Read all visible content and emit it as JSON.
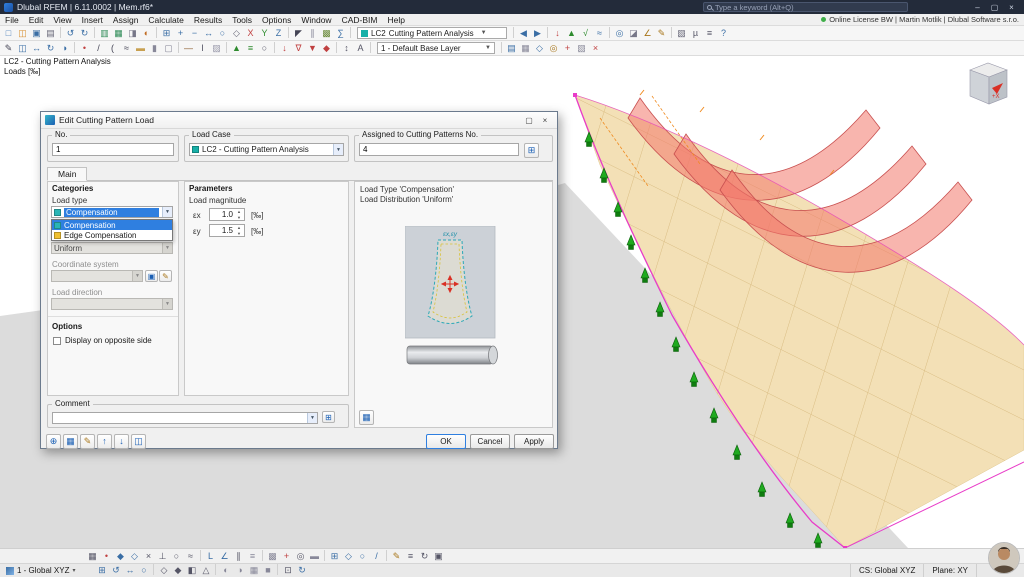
{
  "window": {
    "title": "Dlubal RFEM | 6.11.0002 | Mem.rf6*",
    "search_placeholder": "Type a keyword (Alt+Q)",
    "license": "Online License BW | Martin Motlik | Dlubal Software s.r.o.",
    "controls": [
      {
        "n": "window-minimize",
        "g": "–"
      },
      {
        "n": "window-maximize",
        "g": "▢"
      },
      {
        "n": "window-close",
        "g": "×"
      }
    ]
  },
  "menu": {
    "items": [
      "File",
      "Edit",
      "View",
      "Insert",
      "Assign",
      "Calculate",
      "Results",
      "Tools",
      "Options",
      "Window",
      "CAD-BIM",
      "Help"
    ]
  },
  "toolbar1": {
    "load_case": {
      "code": "LC2",
      "name": "Cutting Pattern Analysis"
    },
    "icons_pre": [
      {
        "n": "new-model",
        "g": "□",
        "c": "#4a7ebb"
      },
      {
        "n": "open-model",
        "g": "◫",
        "c": "#d89030"
      },
      {
        "n": "save-model",
        "g": "▣",
        "c": "#3a6ea5"
      },
      {
        "n": "print-graphic",
        "g": "▤",
        "c": "#667"
      },
      {
        "g": "|"
      },
      {
        "n": "undo",
        "g": "↺",
        "c": "#3a6ea5"
      },
      {
        "n": "redo",
        "g": "↻",
        "c": "#3a6ea5"
      },
      {
        "g": "|"
      },
      {
        "n": "data-navigator",
        "g": "▥",
        "c": "#2e8b57"
      },
      {
        "n": "tables",
        "g": "▦",
        "c": "#2e8b57"
      },
      {
        "n": "display-panel",
        "g": "◨",
        "c": "#778"
      },
      {
        "n": "rendering",
        "g": "◐",
        "c": "#c06a20"
      },
      {
        "g": "|"
      },
      {
        "n": "zoom-window",
        "g": "⊞",
        "c": "#3a6ea5"
      },
      {
        "n": "zoom-in",
        "g": "+",
        "c": "#3a6ea5"
      },
      {
        "n": "zoom-out",
        "g": "−",
        "c": "#3a6ea5"
      },
      {
        "n": "pan-view",
        "g": "↔",
        "c": "#3a6ea5"
      },
      {
        "n": "orbit-view",
        "g": "○",
        "c": "#3a6ea5"
      },
      {
        "n": "view-isometric",
        "g": "◇",
        "c": "#667"
      },
      {
        "n": "view-in-x",
        "g": "X",
        "c": "#c04040"
      },
      {
        "n": "view-in-y",
        "g": "Y",
        "c": "#2e8b2e"
      },
      {
        "n": "view-in-z",
        "g": "Z",
        "c": "#3a6ea5"
      },
      {
        "g": "|"
      },
      {
        "n": "selection-arrow",
        "g": "◤",
        "c": "#445"
      },
      {
        "n": "guidelines",
        "g": "∥",
        "c": "#889"
      },
      {
        "n": "generate-mesh",
        "g": "▩",
        "c": "#6a8a3a"
      },
      {
        "n": "calculate-all",
        "g": "∑",
        "c": "#3a6ea5"
      },
      {
        "g": "|"
      }
    ],
    "icons_post": [
      {
        "g": "|"
      },
      {
        "n": "previous-load-case",
        "g": "◀",
        "c": "#3a6ea5"
      },
      {
        "n": "next-load-case",
        "g": "▶",
        "c": "#3a6ea5"
      },
      {
        "g": "|"
      },
      {
        "n": "show-loads",
        "g": "↓",
        "c": "#c04040"
      },
      {
        "n": "show-supports",
        "g": "▲",
        "c": "#2e8b2e"
      },
      {
        "n": "show-results",
        "g": "√",
        "c": "#2e8b2e"
      },
      {
        "n": "result-diagrams",
        "g": "≈",
        "c": "#3a6ea5"
      },
      {
        "g": "|"
      },
      {
        "n": "visibility-modes",
        "g": "◎",
        "c": "#3a6ea5"
      },
      {
        "n": "clipping-planes",
        "g": "◪",
        "c": "#778"
      },
      {
        "n": "measure",
        "g": "∠",
        "c": "#a8761a"
      },
      {
        "n": "annotations",
        "g": "✎",
        "c": "#a8761a"
      },
      {
        "g": "|"
      },
      {
        "n": "printout-report",
        "g": "▧",
        "c": "#667"
      },
      {
        "n": "units-settings",
        "g": "µ",
        "c": "#556"
      },
      {
        "n": "configuration",
        "g": "≡",
        "c": "#556"
      },
      {
        "n": "help",
        "g": "?",
        "c": "#3a6ea5"
      }
    ]
  },
  "toolbar2": {
    "layer": "1 - Default Base Layer",
    "icons_pre": [
      {
        "n": "edit-mode",
        "g": "✎",
        "c": "#445"
      },
      {
        "n": "copy-object",
        "g": "◫",
        "c": "#3a6ea5"
      },
      {
        "n": "move-object",
        "g": "↔",
        "c": "#3a6ea5"
      },
      {
        "n": "rotate-object",
        "g": "↻",
        "c": "#3a6ea5"
      },
      {
        "n": "mirror-object",
        "g": "◑",
        "c": "#3a6ea5"
      },
      {
        "g": "|"
      },
      {
        "n": "new-node",
        "g": "•",
        "c": "#c04040"
      },
      {
        "n": "new-line",
        "g": "/",
        "c": "#445"
      },
      {
        "n": "new-arc",
        "g": "(",
        "c": "#445"
      },
      {
        "n": "new-spline",
        "g": "≈",
        "c": "#445"
      },
      {
        "n": "new-surface",
        "g": "▬",
        "c": "#c8a050"
      },
      {
        "n": "new-solid",
        "g": "▮",
        "c": "#889"
      },
      {
        "n": "new-opening",
        "g": "▢",
        "c": "#889"
      },
      {
        "g": "|"
      },
      {
        "n": "new-member",
        "g": "—",
        "c": "#8b5a2b"
      },
      {
        "n": "cross-section",
        "g": "I",
        "c": "#556"
      },
      {
        "n": "material",
        "g": "▨",
        "c": "#99a"
      },
      {
        "g": "|"
      },
      {
        "n": "nodal-support",
        "g": "▲",
        "c": "#2e8b2e"
      },
      {
        "n": "line-support",
        "g": "≡",
        "c": "#2e8b2e"
      },
      {
        "n": "member-hinge",
        "g": "○",
        "c": "#556"
      },
      {
        "g": "|"
      },
      {
        "n": "nodal-load",
        "g": "↓",
        "c": "#c04040"
      },
      {
        "n": "line-load",
        "g": "∇",
        "c": "#c04040"
      },
      {
        "n": "surface-load",
        "g": "▼",
        "c": "#c04040"
      },
      {
        "n": "free-load",
        "g": "◆",
        "c": "#c04040"
      },
      {
        "g": "|"
      },
      {
        "n": "dimensions",
        "g": "↕",
        "c": "#556"
      },
      {
        "n": "text-annotation",
        "g": "A",
        "c": "#556"
      },
      {
        "g": "|"
      }
    ],
    "icons_post": [
      {
        "g": "|"
      },
      {
        "n": "layer-manager",
        "g": "▤",
        "c": "#3a6ea5"
      },
      {
        "n": "grid-settings",
        "g": "▦",
        "c": "#889"
      },
      {
        "n": "work-plane",
        "g": "◇",
        "c": "#3a6ea5"
      },
      {
        "n": "snap-settings",
        "g": "◎",
        "c": "#a8761a"
      },
      {
        "n": "user-coordinate-system",
        "g": "+",
        "c": "#c04040"
      },
      {
        "n": "background-layers",
        "g": "▧",
        "c": "#889"
      },
      {
        "n": "delete-object",
        "g": "×",
        "c": "#c04040"
      }
    ]
  },
  "viewport": {
    "info_line1": "LC2 - Cutting Pattern Analysis",
    "info_line2": "Loads [‰]"
  },
  "dialog": {
    "title": "Edit Cutting Pattern Load",
    "controls": [
      {
        "n": "dialog-maximize",
        "g": "▢"
      },
      {
        "n": "dialog-close",
        "g": "×"
      }
    ],
    "no_label": "No.",
    "no_value": "1",
    "load_case_label": "Load Case",
    "load_case_value": "LC2 - Cutting Pattern Analysis",
    "load_case_color": "#18b0a8",
    "assigned_label": "Assigned to Cutting Patterns No.",
    "assigned_value": "4",
    "assigned_button_glyph": "⊞",
    "tab_main": "Main",
    "categories": {
      "header": "Categories",
      "load_type_label": "Load type",
      "load_type_value": "Compensation",
      "options": [
        {
          "label": "Compensation",
          "color": "#2ab5b5",
          "selected": true
        },
        {
          "label": "Edge Compensation",
          "color": "#f0c030",
          "selected": false
        }
      ],
      "load_distribution_value": "Uniform",
      "coordinate_system_label": "Coordinate system",
      "cs_buttons": [
        {
          "n": "new-coordinate-system",
          "g": "▣",
          "c": "#1a5fb4"
        },
        {
          "n": "edit-coordinate-system",
          "g": "✎",
          "c": "#a8761a"
        }
      ],
      "load_direction_label": "Load direction",
      "options_header": "Options",
      "checkbox_label": "Display on opposite side"
    },
    "parameters": {
      "header": "Parameters",
      "load_magnitude_label": "Load magnitude",
      "ex_label": "εx",
      "ex_value": "1.0",
      "ex_unit": "[‰]",
      "ey_label": "εy",
      "ey_value": "1.5",
      "ey_unit": "[‰]"
    },
    "preview": {
      "line1": "Load Type 'Compensation'",
      "line2": "Load Distribution 'Uniform'",
      "diagram_label": "εx,εy",
      "tool_glyph": "▦"
    },
    "comment_label": "Comment",
    "comment_value": "",
    "comment_button_glyph": "⊞",
    "tool_buttons": [
      {
        "n": "zoom-to-load",
        "g": "⊕",
        "c": "#1a5fb4"
      },
      {
        "n": "show-table",
        "g": "▦",
        "c": "#1a5fb4"
      },
      {
        "n": "edit-parameters",
        "g": "✎",
        "c": "#a8761a"
      },
      {
        "n": "previous-load",
        "g": "↑",
        "c": "#1a5fb4"
      },
      {
        "n": "next-load",
        "g": "↓",
        "c": "#1a5fb4"
      },
      {
        "n": "copy-load",
        "g": "◫",
        "c": "#1a5fb4"
      }
    ],
    "buttons": {
      "ok": "OK",
      "cancel": "Cancel",
      "apply": "Apply"
    }
  },
  "statusbar": {
    "coord_system": "1 - Global XYZ",
    "cs": "CS: Global XYZ",
    "plane": "Plane: XY",
    "icons_row1": [
      {
        "n": "snap-grid",
        "g": "▦",
        "c": "#556"
      },
      {
        "n": "snap-nodes",
        "g": "•",
        "c": "#c04040"
      },
      {
        "n": "snap-endpoints",
        "g": "◆",
        "c": "#3a6ea5"
      },
      {
        "n": "snap-midpoints",
        "g": "◇",
        "c": "#3a6ea5"
      },
      {
        "n": "snap-intersections",
        "g": "×",
        "c": "#556"
      },
      {
        "n": "snap-perpendicular",
        "g": "⊥",
        "c": "#556"
      },
      {
        "n": "snap-tangent",
        "g": "○",
        "c": "#556"
      },
      {
        "n": "snap-nearest",
        "g": "≈",
        "c": "#556"
      },
      {
        "g": "|"
      },
      {
        "n": "ortho-mode",
        "g": "L",
        "c": "#3a6ea5"
      },
      {
        "n": "polar-tracking",
        "g": "∠",
        "c": "#3a6ea5"
      },
      {
        "n": "object-tracking",
        "g": "∥",
        "c": "#556"
      },
      {
        "n": "guidelines-toggle",
        "g": "≡",
        "c": "#889"
      },
      {
        "g": "|"
      },
      {
        "n": "grid-toggle",
        "g": "▩",
        "c": "#889"
      },
      {
        "n": "axes-toggle",
        "g": "+",
        "c": "#c04040"
      },
      {
        "n": "crosshair-toggle",
        "g": "◎",
        "c": "#556"
      },
      {
        "n": "ruler-toggle",
        "g": "▬",
        "c": "#889"
      },
      {
        "g": "|"
      },
      {
        "n": "select-window",
        "g": "⊞",
        "c": "#3a6ea5"
      },
      {
        "n": "select-rhombus",
        "g": "◇",
        "c": "#3a6ea5"
      },
      {
        "n": "select-circle",
        "g": "○",
        "c": "#3a6ea5"
      },
      {
        "n": "select-line",
        "g": "/",
        "c": "#3a6ea5"
      },
      {
        "g": "|"
      },
      {
        "n": "dynamic-input",
        "g": "✎",
        "c": "#a8761a"
      },
      {
        "n": "coordinate-display",
        "g": "≡",
        "c": "#556"
      },
      {
        "n": "snap-rotation",
        "g": "↻",
        "c": "#556"
      },
      {
        "n": "lock-view",
        "g": "▣",
        "c": "#556"
      }
    ],
    "icons_row2": [
      {
        "n": "zoom-all",
        "g": "⊞",
        "c": "#3a6ea5"
      },
      {
        "n": "zoom-previous",
        "g": "↺",
        "c": "#3a6ea5"
      },
      {
        "n": "pan",
        "g": "↔",
        "c": "#3a6ea5"
      },
      {
        "n": "orbit",
        "g": "○",
        "c": "#3a6ea5"
      },
      {
        "g": "|"
      },
      {
        "n": "view-xy",
        "g": "◇",
        "c": "#556"
      },
      {
        "n": "view-xz",
        "g": "◆",
        "c": "#556"
      },
      {
        "n": "view-yz",
        "g": "◧",
        "c": "#556"
      },
      {
        "n": "perspective",
        "g": "△",
        "c": "#556"
      },
      {
        "g": "|"
      },
      {
        "n": "shadow-toggle",
        "g": "◐",
        "c": "#889"
      },
      {
        "n": "transparency",
        "g": "◑",
        "c": "#889"
      },
      {
        "n": "wireframe",
        "g": "▦",
        "c": "#889"
      },
      {
        "n": "solid-display",
        "g": "■",
        "c": "#889"
      },
      {
        "g": "|"
      },
      {
        "n": "fullscreen",
        "g": "⊡",
        "c": "#556"
      },
      {
        "n": "refresh-view",
        "g": "↻",
        "c": "#3a6ea5"
      }
    ]
  }
}
